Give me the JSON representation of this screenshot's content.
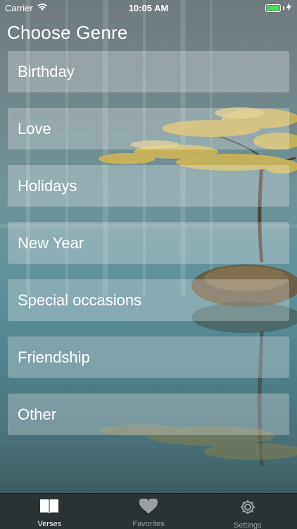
{
  "status_bar": {
    "carrier": "Carrier",
    "time": "10:05 AM",
    "battery_level": 1.0
  },
  "header": {
    "title": "Choose Genre"
  },
  "genres": [
    {
      "label": "Birthday"
    },
    {
      "label": "Love"
    },
    {
      "label": "Holidays"
    },
    {
      "label": "New Year"
    },
    {
      "label": "Special occasions"
    },
    {
      "label": "Friendship"
    },
    {
      "label": "Other"
    }
  ],
  "tab_bar": {
    "tabs": [
      {
        "label": "Verses",
        "icon": "book-icon",
        "active": true
      },
      {
        "label": "Favorites",
        "icon": "heart-icon",
        "active": false
      },
      {
        "label": "Settings",
        "icon": "gear-icon",
        "active": false
      }
    ]
  },
  "colors": {
    "battery": "#4cd964",
    "tabbar": "#2b3233",
    "active_tab": "#ffffff",
    "inactive_tab": "#9aa0a1"
  }
}
